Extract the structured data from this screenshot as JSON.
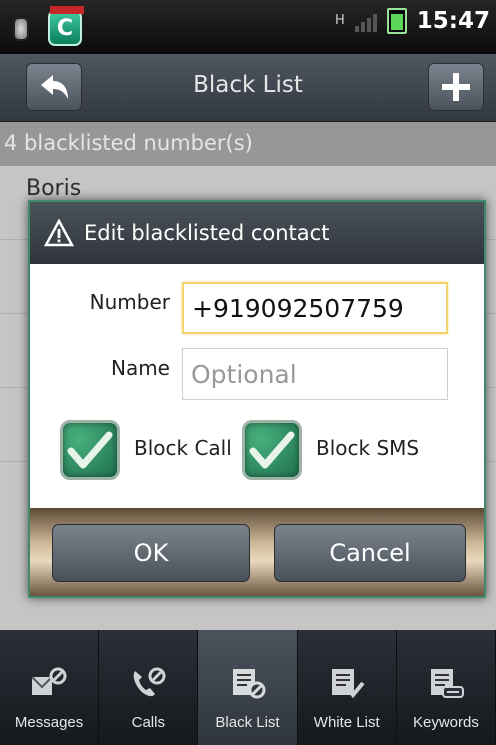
{
  "status_bar": {
    "network_type": "H",
    "time": "15:47"
  },
  "title_bar": {
    "title": "Black List"
  },
  "list": {
    "count_text": "4 blacklisted number(s)",
    "first_contact": "Boris"
  },
  "dialog": {
    "title": "Edit blacklisted contact",
    "number_label": "Number",
    "number_value": "+919092507759",
    "name_label": "Name",
    "name_placeholder": "Optional",
    "block_call_label": "Block Call",
    "block_sms_label": "Block SMS",
    "ok_label": "OK",
    "cancel_label": "Cancel"
  },
  "tabs": [
    {
      "label": "Messages",
      "icon": "message-block-icon"
    },
    {
      "label": "Calls",
      "icon": "phone-block-icon"
    },
    {
      "label": "Black List",
      "icon": "blacklist-icon"
    },
    {
      "label": "White List",
      "icon": "whitelist-icon"
    },
    {
      "label": "Keywords",
      "icon": "keywords-icon"
    }
  ],
  "colors": {
    "accent_green": "#3f8a6b",
    "active_tab": "#4a525c",
    "focus_border": "#f3d36b"
  }
}
